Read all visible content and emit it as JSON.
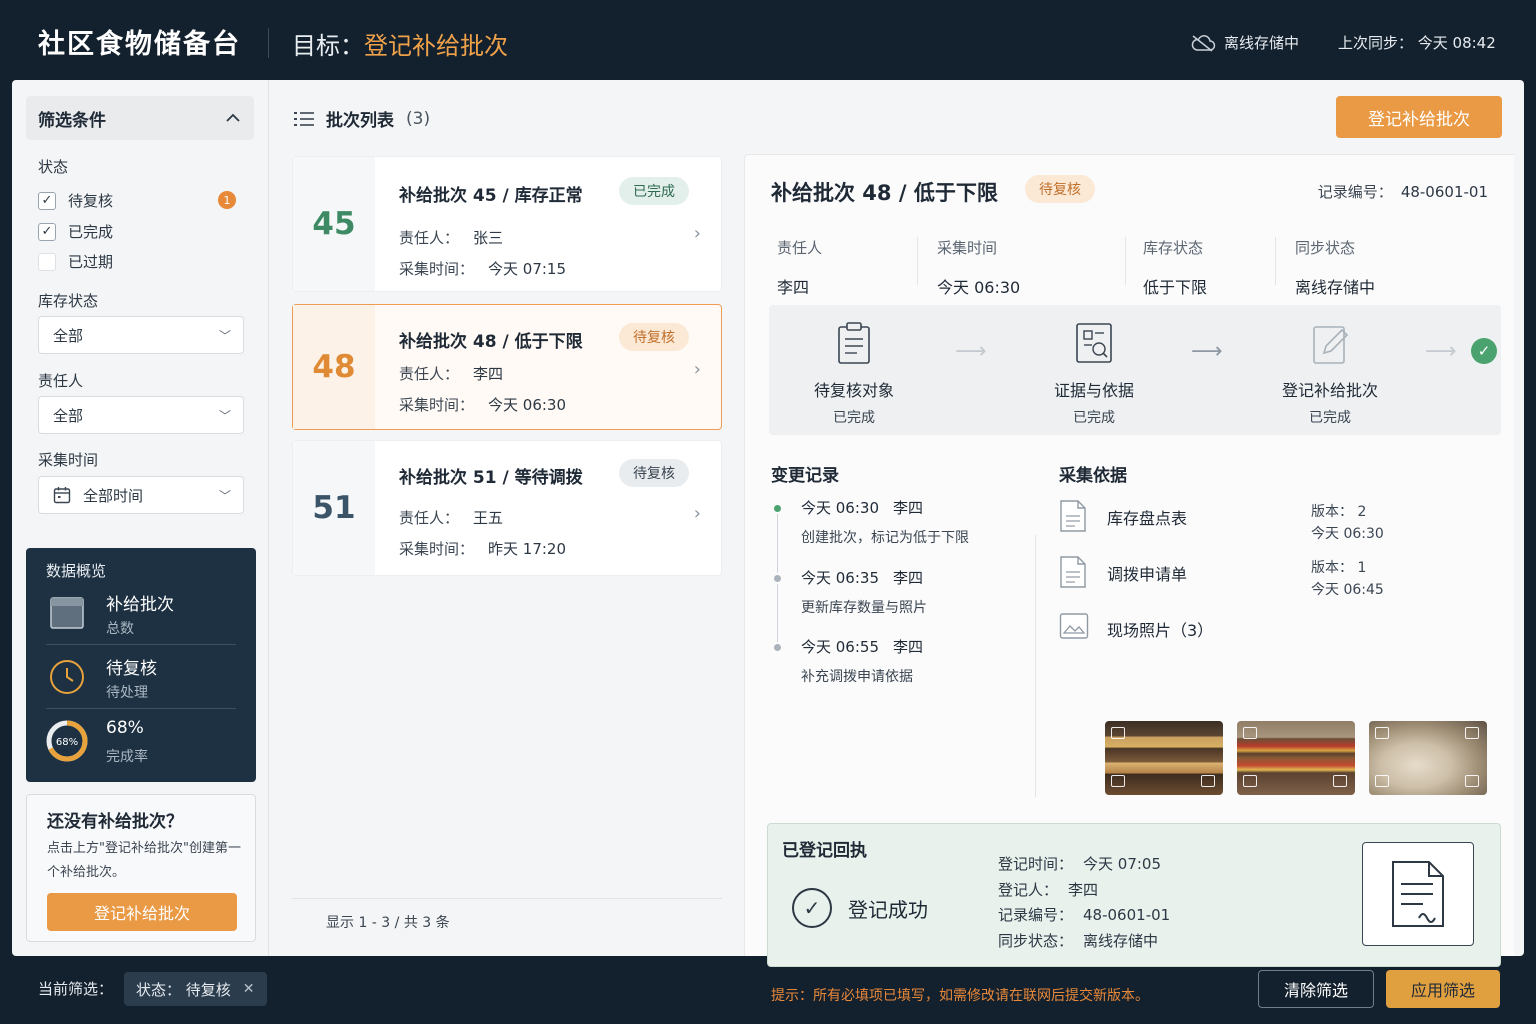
{
  "header": {
    "app_title": "社区食物储备台",
    "goal_label": "目标：",
    "goal_value": "登记补给批次",
    "offline_text": "离线存储中",
    "sync_text": "上次同步：  今天 08:42"
  },
  "sidebar": {
    "filter_title": "筛选条件",
    "status_label": "状态",
    "status_options": [
      {
        "label": "待复核",
        "checked": true,
        "badge": "1"
      },
      {
        "label": "已完成",
        "checked": true
      },
      {
        "label": "已过期",
        "checked": false
      }
    ],
    "stock_label": "库存状态",
    "stock_value": "全部",
    "owner_label": "责任人",
    "owner_value": "全部",
    "time_label": "采集时间",
    "time_value": "全部时间",
    "overview": {
      "title": "数据概览",
      "items": [
        {
          "main": "补给批次",
          "sub": "总数"
        },
        {
          "main": "待复核",
          "sub": "待处理"
        },
        {
          "main": "68%",
          "sub": "完成率",
          "ring_label": "68%",
          "percent": 68
        }
      ]
    },
    "empty": {
      "title": "还没有补给批次？",
      "desc": "点击上方\"登记补给批次\"创建第一个补给批次。",
      "button": "登记补给批次"
    }
  },
  "list": {
    "title": "批次列表",
    "count": "(3)",
    "owner_key": "责任人：",
    "time_key": "采集时间：",
    "cards": [
      {
        "num": "45",
        "title": "补给批次 45 / 库存正常",
        "tag": "已完成",
        "owner": "张三",
        "time": "今天 07:15",
        "num_color": "#3d8a64"
      },
      {
        "num": "48",
        "title": "补给批次 48 / 低于下限",
        "tag": "待复核",
        "owner": "李四",
        "time": "今天 06:30",
        "num_color": "#e08a35"
      },
      {
        "num": "51",
        "title": "补给批次 51 / 等待调拨",
        "tag": "待复核",
        "owner": "王五",
        "time": "昨天 17:20",
        "num_color": "#3b5468"
      }
    ],
    "pager": "显示 1 - 3 / 共 3 条"
  },
  "register_button": "登记补给批次",
  "detail": {
    "title": "补给批次 48 / 低于下限",
    "tag": "待复核",
    "record_key": "记录编号：",
    "record_value": "48-0601-01",
    "meta": [
      {
        "key": "责任人",
        "value": "李四"
      },
      {
        "key": "采集时间",
        "value": "今天 06:30"
      },
      {
        "key": "库存状态",
        "value": "低于下限"
      },
      {
        "key": "同步状态",
        "value": "离线存储中"
      }
    ],
    "steps": [
      {
        "name": "待复核对象",
        "state": "已完成"
      },
      {
        "name": "证据与依据",
        "state": "已完成"
      },
      {
        "name": "登记补给批次",
        "state": "已完成"
      }
    ],
    "changes_title": "变更记录",
    "changes": [
      {
        "time": "今天 06:30",
        "who": "李四",
        "desc": "创建批次，标记为低于下限"
      },
      {
        "time": "今天 06:35",
        "who": "李四",
        "desc": "更新库存数量与照片"
      },
      {
        "time": "今天 06:55",
        "who": "李四",
        "desc": "补充调拨申请依据"
      }
    ],
    "evidence_title": "采集依据",
    "evidence": [
      {
        "name": "库存盘点表",
        "version": "版本：  2",
        "time": "今天 06:30"
      },
      {
        "name": "调拨申请单",
        "version": "版本：  1",
        "time": "今天 06:45"
      },
      {
        "name": "现场照片（3）"
      }
    ],
    "receipt": {
      "title": "已登记回执",
      "status": "登记成功",
      "fields": [
        {
          "key": "登记时间：",
          "value": "今天 07:05"
        },
        {
          "key": "登记人：",
          "value": "李四"
        },
        {
          "key": "记录编号：",
          "value": "48-0601-01"
        },
        {
          "key": "同步状态：",
          "value": "离线存储中"
        }
      ]
    },
    "hint": "提示：所有必填项已填写，如需修改请在联网后提交新版本。"
  },
  "bottom": {
    "current_filter_label": "当前筛选：",
    "chip": "状态：  待复核",
    "clear": "清除筛选",
    "apply": "应用筛选"
  },
  "colors": {
    "accent_orange": "#ea9a45",
    "success_green": "#4aa36e",
    "dark_navy": "#13202d"
  }
}
